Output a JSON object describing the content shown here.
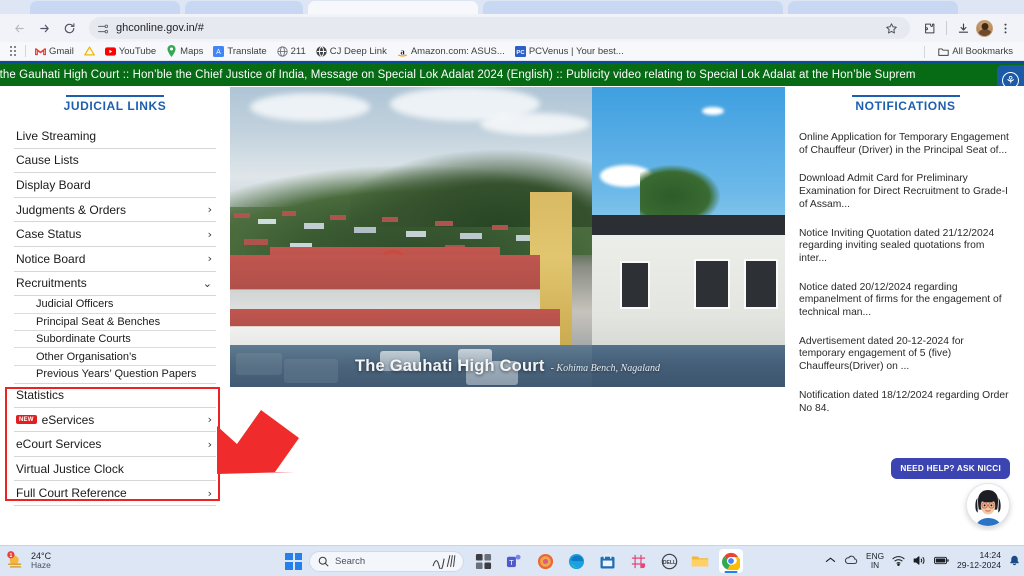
{
  "browser": {
    "url": "ghconline.gov.in/#",
    "nav": {
      "back": "←",
      "forward": "→",
      "reload": "↻"
    },
    "omni_icons": {
      "site_settings": "tune-icon",
      "bookmark": "star-icon"
    },
    "toolbar_icons": {
      "extensions": "extensions-icon",
      "downloads": "download-icon",
      "profile": "profile-avatar"
    },
    "bookmarks": [
      {
        "label": "Gmail",
        "icon": "gmail-icon"
      },
      {
        "label": "YouTube",
        "icon": "youtube-icon"
      },
      {
        "label": "Maps",
        "icon": "maps-pin-icon"
      },
      {
        "label": "Translate",
        "icon": "translate-icon"
      },
      {
        "label": "211",
        "icon": "globe-icon"
      },
      {
        "label": "CJ Deep Link",
        "icon": "globe-icon"
      },
      {
        "label": "Amazon.com: ASUS...",
        "icon": "amazon-icon"
      },
      {
        "label": "PCVenus | Your best...",
        "icon": "pcvenus-icon"
      }
    ],
    "all_bookmarks": "All Bookmarks"
  },
  "marquee": {
    "text": "t the Gauhati High Court :: Hon’ble the Chief Justice of India, Message on Special Lok Adalat 2024 (English) :: Publicity video relating to Special Lok Adalat at the Hon’ble Suprem",
    "accessibility_icon": "accessibility-icon"
  },
  "sidebar": {
    "title": "JUDICIAL LINKS",
    "items": [
      {
        "label": "Live Streaming",
        "chevron": false
      },
      {
        "label": "Cause Lists",
        "chevron": false
      },
      {
        "label": "Display Board",
        "chevron": false
      },
      {
        "label": "Judgments & Orders",
        "chevron": true
      },
      {
        "label": "Case Status",
        "chevron": true
      },
      {
        "label": "Notice Board",
        "chevron": true
      }
    ],
    "recruitments": {
      "label": "Recruitments",
      "expanded": true,
      "chevron_glyph": "⌄",
      "sub_items": [
        "Judicial Officers",
        "Principal Seat & Benches",
        "Subordinate Courts",
        "Other Organisation’s",
        "Previous Years’ Question Papers"
      ]
    },
    "items_after": [
      {
        "label": "Statistics",
        "chevron": false,
        "badge": null
      },
      {
        "label": "eServices",
        "chevron": true,
        "badge": "NEW"
      },
      {
        "label": "eCourt Services",
        "chevron": true,
        "badge": null
      },
      {
        "label": "Virtual Justice Clock",
        "chevron": false,
        "badge": null
      },
      {
        "label": "Full Court Reference",
        "chevron": true,
        "badge": null
      }
    ],
    "highlight_color": "#ee2222",
    "annotation": "red-highlight-box-and-arrow"
  },
  "hero": {
    "caption_main": "The Gauhati High Court",
    "caption_sub": "- Kohima Bench, Nagaland"
  },
  "notifications": {
    "title": "NOTIFICATIONS",
    "items": [
      "Online Application for Temporary Engagement of Chauffeur (Driver) in the Principal Seat of...",
      "Download Admit Card for Preliminary Examination for Direct Recruitment to Grade-I of Assam...",
      "Notice Inviting Quotation dated 21/12/2024 regarding inviting sealed quotations from inter...",
      "Notice dated 20/12/2024 regarding empanelment of firms for the engagement of technical man...",
      "Advertisement dated 20-12-2024 for temporary engagement of 5 (five) Chauffeurs(Driver) on ...",
      "Notification dated 18/12/2024 regarding Order No 84."
    ]
  },
  "chat_widget": {
    "pill_label": "NEED HELP? ASK NICCI",
    "avatar": "nicci-assistant-avatar",
    "accent": "#3b44b0"
  },
  "taskbar": {
    "weather": {
      "temperature": "24°C",
      "condition": "Haze",
      "icon": "haze-icon",
      "badge": "1"
    },
    "search_placeholder": "Search",
    "apps": [
      "widgets-icon",
      "copilot-icon",
      "edge-icon",
      "store-icon",
      "snipping-tool-icon",
      "dell-icon",
      "file-explorer-icon",
      "chrome-icon"
    ],
    "tray": {
      "overflow": "chevron-up-icon",
      "onedrive": "onedrive-icon",
      "language": "ENG\nIN",
      "language_line1": "ENG",
      "language_line2": "IN",
      "wifi": "wifi-icon",
      "volume": "volume-icon",
      "battery": "battery-icon",
      "time": "14:24",
      "date": "29-12-2024",
      "notification": "bell-icon"
    }
  }
}
